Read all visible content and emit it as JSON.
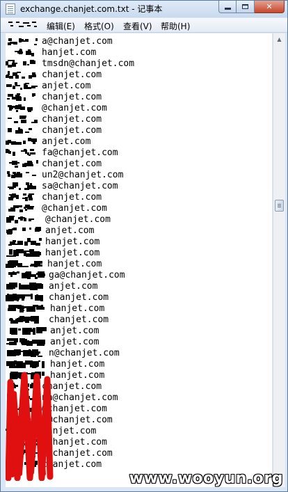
{
  "window": {
    "title": "exchange.chanjet.com.txt - 记事本",
    "title_icon": "notepad-icon"
  },
  "caption_buttons": {
    "minimize_icon": "minimize-icon",
    "maximize_icon": "maximize-icon",
    "close_label": "✕",
    "close_color": "#c7452c"
  },
  "menu": {
    "file_label": "",
    "edit_label": "编辑(E)",
    "format_label": "格式(O)",
    "view_label": "查看(V)",
    "help_label": "帮助(H)"
  },
  "lines": [
    "a@chanjet.com",
    "hanjet.com",
    "tmsdn@chanjet.com",
    "chanjet.com",
    "anjet.com",
    "chanjet.com",
    "@chanjet.com",
    "chanjet.com",
    "chanjet.com",
    "anjet.com",
    "fa@chanjet.com",
    "chanjet.com",
    "un2@chanjet.com",
    "sa@chanjet.com",
    "chanjet.com",
    "@chanjet.com",
    "@chanjet.com",
    "anjet.com",
    "hanjet.com",
    "hanjet.com",
    "hanjet.com",
    "ga@chanjet.com",
    "anjet.com",
    "chanjet.com",
    "hanjet.com",
    "chanjet.com",
    "anjet.com",
    "anjet.com",
    "n@chanjet.com",
    "hanjet.com",
    "hanjet.com",
    "chanjet.com",
    "na@chanjet.com",
    "@chanjet.com",
    "l@chanjet.com",
    "hanjet.com",
    "@chanjet.com",
    "g@chanjet.com",
    "chanjet.com"
  ],
  "scrollbar": {
    "up_icon": "scroll-up-arrow-icon",
    "down_icon": "scroll-down-arrow-icon",
    "position_fraction": 0.37
  },
  "watermark": {
    "text": "www.wooyun.org"
  },
  "colors": {
    "redaction": "#000000",
    "marker": "#e01010"
  }
}
